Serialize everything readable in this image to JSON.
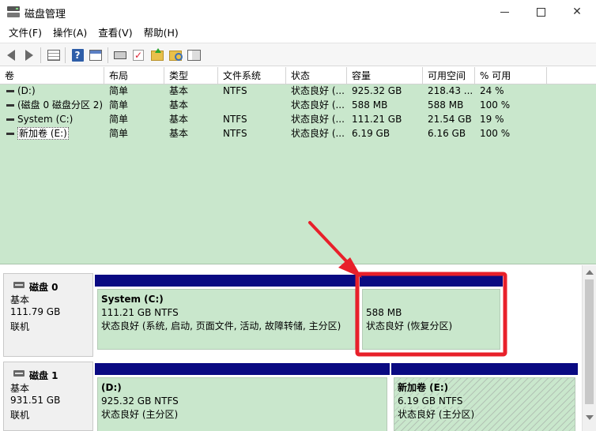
{
  "window": {
    "title": "磁盘管理",
    "minimize_icon": "minimize-icon",
    "maximize_icon": "maximize-icon",
    "close_glyph": "✕"
  },
  "menu": [
    "文件(F)",
    "操作(A)",
    "查看(V)",
    "帮助(H)"
  ],
  "toolbar": {
    "icons": [
      "back-arrow-icon",
      "forward-arrow-icon",
      "console-tree-icon",
      "help-icon",
      "show-panel-icon",
      "connect-drive-icon",
      "checklist-icon",
      "folder-up-icon",
      "search-folder-icon",
      "list-view-icon"
    ],
    "help_glyph": "?"
  },
  "volume_table": {
    "columns": [
      "卷",
      "布局",
      "类型",
      "文件系统",
      "状态",
      "容量",
      "可用空间",
      "% 可用"
    ],
    "rows": [
      {
        "volume": "(D:)",
        "layout": "简单",
        "type": "基本",
        "fs": "NTFS",
        "status": "状态良好 (...",
        "capacity": "925.32 GB",
        "free": "218.43 ...",
        "pct": "24 %"
      },
      {
        "volume": "(磁盘 0 磁盘分区 2)",
        "layout": "简单",
        "type": "基本",
        "fs": "",
        "status": "状态良好 (...",
        "capacity": "588 MB",
        "free": "588 MB",
        "pct": "100 %"
      },
      {
        "volume": "System (C:)",
        "layout": "简单",
        "type": "基本",
        "fs": "NTFS",
        "status": "状态良好 (...",
        "capacity": "111.21 GB",
        "free": "21.54 GB",
        "pct": "19 %"
      },
      {
        "volume": "新加卷 (E:)",
        "layout": "简单",
        "type": "基本",
        "fs": "NTFS",
        "status": "状态良好 (...",
        "capacity": "6.19 GB",
        "free": "6.16 GB",
        "pct": "100 %"
      }
    ]
  },
  "disks": [
    {
      "name": "磁盘 0",
      "type": "基本",
      "size": "111.79 GB",
      "state": "联机",
      "partitions": [
        {
          "title": "System  (C:)",
          "size": "111.21 GB NTFS",
          "status": "状态良好 (系统, 启动, 页面文件, 活动, 故障转储, 主分区)"
        },
        {
          "title": "",
          "size": "588 MB",
          "status": "状态良好 (恢复分区)"
        }
      ]
    },
    {
      "name": "磁盘 1",
      "type": "基本",
      "size": "931.51 GB",
      "state": "联机",
      "partitions": [
        {
          "title": "(D:)",
          "size": "925.32 GB NTFS",
          "status": "状态良好 (主分区)"
        },
        {
          "title": "新加卷  (E:)",
          "size": "6.19 GB NTFS",
          "status": "状态良好 (主分区)"
        }
      ]
    }
  ],
  "colors": {
    "partition_bar": "#0a0a82",
    "primary_fill": "#c9e7cc",
    "highlight": "#e8202a"
  }
}
